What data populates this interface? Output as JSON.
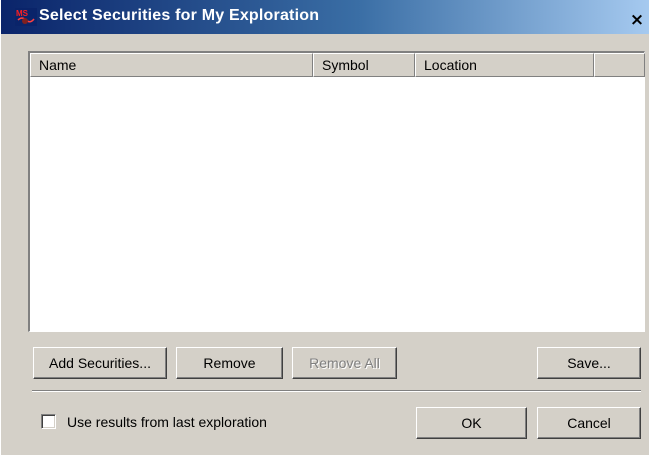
{
  "window": {
    "title": "Select Securities for My Exploration",
    "close_glyph": "×",
    "app_icon": "metastock-icon"
  },
  "list": {
    "columns": [
      "Name",
      "Symbol",
      "Location",
      ""
    ],
    "rows": []
  },
  "buttons": {
    "add_securities": "Add Securities...",
    "remove": "Remove",
    "remove_all": "Remove All",
    "save": "Save...",
    "ok": "OK",
    "cancel": "Cancel"
  },
  "options": {
    "use_last_results_label": "Use results from last exploration",
    "use_last_results_checked": false
  },
  "colors": {
    "titlebar_start": "#0a246a",
    "titlebar_end": "#a6caf0",
    "face": "#d4d0c8"
  }
}
